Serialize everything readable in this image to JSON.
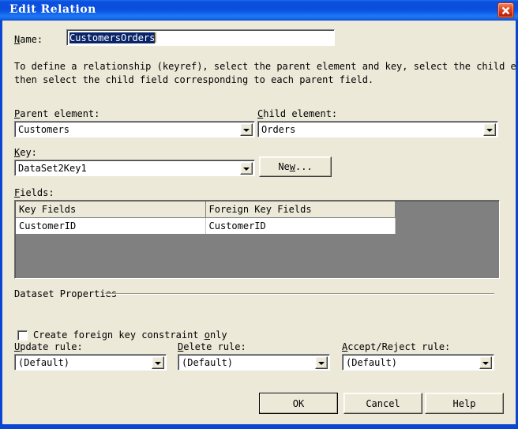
{
  "window": {
    "title": "Edit Relation",
    "close_icon": "close-icon",
    "title_bar_color": "#0a50e0",
    "client_bg": "#ece9d8"
  },
  "name_field": {
    "label": "Name:",
    "value": "CustomersOrders",
    "selected": true
  },
  "description": {
    "line1": "To define a relationship (keyref), select the parent element and key, select the child element, and",
    "line2": "then select the child field corresponding to each parent field."
  },
  "parent_element": {
    "label": "Parent element:",
    "value": "Customers"
  },
  "child_element": {
    "label": "Child element:",
    "value": "Orders"
  },
  "key": {
    "label": "Key:",
    "value": "DataSet2Key1",
    "new_button": "New..."
  },
  "fields": {
    "label": "Fields:",
    "columns": [
      "Key Fields",
      "Foreign Key Fields"
    ],
    "rows": [
      {
        "key_field": "CustomerID",
        "foreign_key_field": "CustomerID"
      }
    ]
  },
  "dataset_properties": {
    "group_label": "Dataset Properties",
    "checkbox_label": "Create foreign key constraint only",
    "checkbox_checked": false,
    "update_rule": {
      "label": "Update rule:",
      "value": "(Default)"
    },
    "delete_rule": {
      "label": "Delete rule:",
      "value": "(Default)"
    },
    "accept_reject_rule": {
      "label": "Accept/Reject rule:",
      "value": "(Default)"
    }
  },
  "buttons": {
    "ok": "OK",
    "cancel": "Cancel",
    "help": "Help"
  }
}
